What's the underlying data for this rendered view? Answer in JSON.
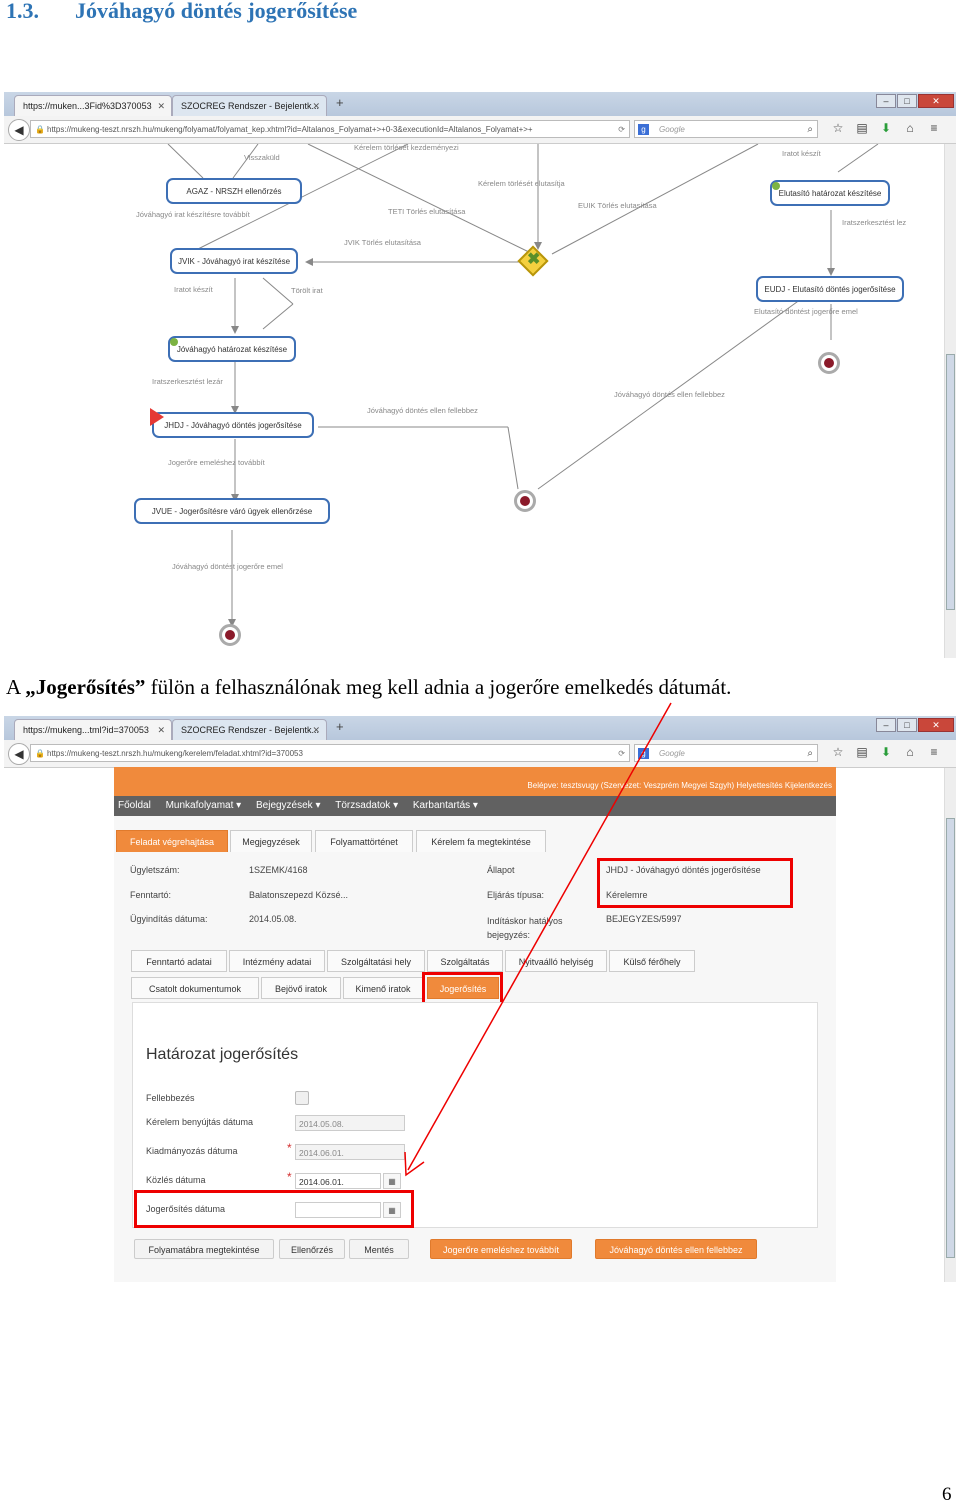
{
  "heading": {
    "number": "1.3.",
    "title": "Jóváhagyó döntés jogerősítése"
  },
  "caption": {
    "prefix": "A ",
    "bold": "„Jogerősítés”",
    "rest": " fülön a felhasználónak meg kell adnia a jogerőre emelkedés dátumát."
  },
  "page_number": "6",
  "screenshot1": {
    "tab1": "https://muken...3Fid%3D370053",
    "tab2": "SZOCREG Rendszer - Bejelentk...",
    "url": "https://mukeng-teszt.nrszh.hu/mukeng/folyamat/folyamat_kep.xhtml?id=Altalanos_Folyamat+>+0-3&executionId=Altalanos_Folyamat+>+",
    "search_placeholder": "Google",
    "nodes": {
      "agaz": "AGAZ - NRSZH ellenőrzés",
      "jvik": "JVIK - Jóváhagyó irat készítése",
      "jhat": "Jóváhagyó határozat készítése",
      "jhdj": "JHDJ - Jóváhagyó döntés jogerősítése",
      "jvue": "JVUE - Jogerősítésre váró ügyek ellenőrzése",
      "elut": "Elutasító határozat készítése",
      "eudj": "EUDJ - Elutasító döntés jogerősítése"
    },
    "labels": {
      "visszakuld": "Visszaküld",
      "kerelem_torleset": "Kérelem törlését kezdeményezi",
      "iratot_keszit_top": "Iratot készít",
      "kerelem_torlese_elut": "Kérelem törlését elutasítja",
      "jovahagyo_irat_tovabbit": "Jóváhagyó irat készítésre továbbít",
      "teti": "TETI Törlés elutasítása",
      "euik": "EUIK Törlés elutasítása",
      "iratszerk_lez_right": "Iratszerkesztést lez",
      "jvik_torles": "JVIK Törlés elutasítása",
      "iratot_keszit": "Iratot készít",
      "torolt_irat": "Törölt irat",
      "elut_jogerore": "Elutasító döntést jogerőre emel",
      "iratszerk_lezar": "Iratszerkesztést lezár",
      "fellebbez_right": "Jóváhagyó döntés ellen fellebbez",
      "fellebbez_mid": "Jóváhagyó döntés ellen fellebbez",
      "jogerore_tovabbit": "Jogerőre emeléshez továbbít",
      "jogerore_emel": "Jóváhagyó döntést jogerőre emel"
    }
  },
  "screenshot2": {
    "tab1": "https://mukeng...tml?id=370053",
    "tab2": "SZOCREG Rendszer - Bejelentk...",
    "url": "https://mukeng-teszt.nrszh.hu/mukeng/kerelem/feladat.xhtml?id=370053",
    "search_placeholder": "Google",
    "userbar": "Belépve: tesztsvugy (Szervezet: Veszprém Megyei Szgyh)   Helyettesítés   Kijelentkezés",
    "menu": [
      "Főoldal",
      "Munkafolyamat ▾",
      "Bejegyzések ▾",
      "Törzsadatok ▾",
      "Karbantartás ▾"
    ],
    "tabs": [
      "Feladat végrehajtása",
      "Megjegyzések",
      "Folyamattörténet",
      "Kérelem fa megtekintése"
    ],
    "fields": {
      "ugyletszam_label": "Ügyletszám:",
      "ugyletszam": "1SZEMK/4168",
      "fenntarto_label": "Fenntartó:",
      "fenntarto": "Balatonszepezd Közsé...",
      "ugyinditas_label": "Ügyindítás dátuma:",
      "ugyinditas": "2014.05.08.",
      "allapot_label": "Állapot",
      "allapot": "JHDJ - Jóváhagyó döntés jogerősítése",
      "eljaras_label": "Eljárás típusa:",
      "eljaras": "Kérelemre",
      "inditaskor_label": "Indításkor hatályos bejegyzés:",
      "inditaskor": "BEJEGYZES/5997"
    },
    "subtabs_row1": [
      "Fenntartó adatai",
      "Intézmény adatai",
      "Szolgáltatási hely",
      "Szolgáltatás",
      "Nyitvaálló helyiség",
      "Külső férőhely"
    ],
    "subtabs_row2": [
      "Csatolt dokumentumok",
      "Bejövő iratok",
      "Kimenő iratok",
      "Jogerősítés"
    ],
    "panel_title": "Határozat jogerősítés",
    "form": {
      "fellebbezes": "Fellebbezés",
      "kerelem_label": "Kérelem benyújtás dátuma",
      "kerelem_value": "2014.05.08.",
      "kiadmanyozas_label": "Kiadmányozás dátuma",
      "kiadmanyozas_value": "2014.06.01.",
      "kozles_label": "Közlés dátuma",
      "kozles_value": "2014.06.01.",
      "jogerosites_label": "Jogerősítés dátuma",
      "jogerosites_value": "",
      "required_mark": "*"
    },
    "buttons": [
      "Folyamatábra megtekintése",
      "Ellenőrzés",
      "Mentés",
      "Jogerőre emeléshez továbbít",
      "Jóváhagyó döntés ellen fellebbez"
    ]
  },
  "colors": {
    "heading": "#2e74b5",
    "accent": "#f08a3c",
    "highlight": "#e00000",
    "node_border": "#3d6fb5"
  }
}
